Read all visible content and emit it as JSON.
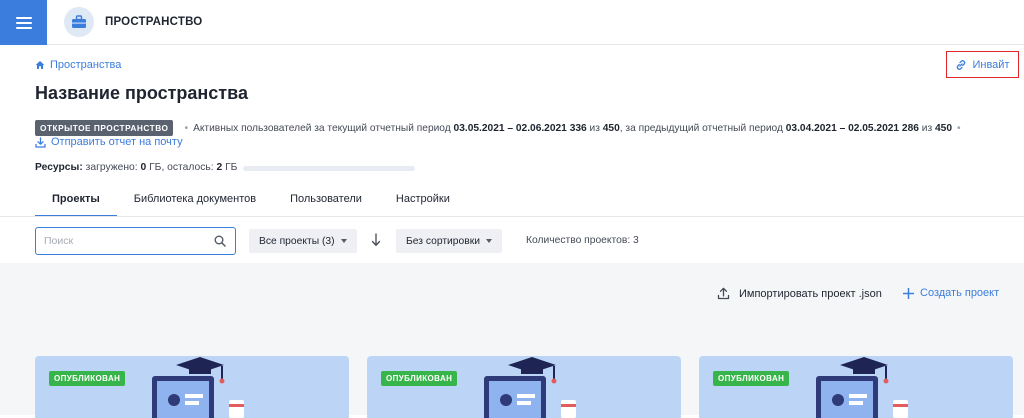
{
  "app": {
    "title": "ПРОСТРАНСТВО"
  },
  "breadcrumb": {
    "label": "Пространства"
  },
  "invite": {
    "label": "Инвайт"
  },
  "page": {
    "title": "Название пространства"
  },
  "space_info": {
    "badge": "ОТКРЫТОЕ ПРОСТРАНСТВО",
    "current_prefix": "Активных пользователей за текущий отчетный период",
    "current_period": "03.05.2021 – 02.06.2021",
    "current_active": "336",
    "of_word": "из",
    "current_total": "450",
    "previous_prefix": ", за предыдущий отчетный период",
    "previous_period": "03.04.2021 – 02.05.2021",
    "previous_active": "286",
    "previous_total": "450",
    "send_report": "Отправить отчет на почту"
  },
  "resources": {
    "label": "Ресурсы:",
    "loaded_label": "загружено:",
    "loaded_value": "0",
    "unit": "ГБ",
    "remaining_label": ", осталось:",
    "remaining_value": "2",
    "used_fraction": 0
  },
  "tabs": [
    {
      "label": "Проекты",
      "active": true
    },
    {
      "label": "Библиотека документов",
      "active": false
    },
    {
      "label": "Пользователи",
      "active": false
    },
    {
      "label": "Настройки",
      "active": false
    }
  ],
  "toolbar": {
    "search_placeholder": "Поиск",
    "filter_value": "Все проекты (3)",
    "sort_value": "Без сортировки",
    "count_text": "Количество проектов: 3"
  },
  "actions": {
    "import_label": "Импортировать проект .json",
    "create_label": "Создать проект"
  },
  "projects": [
    {
      "status": "ОПУБЛИКОВАН"
    },
    {
      "status": "ОПУБЛИКОВАН"
    },
    {
      "status": "ОПУБЛИКОВАН"
    }
  ],
  "colors": {
    "accent": "#3b7ddd",
    "published": "#38b54a",
    "invite_outline": "#e0262b",
    "badge": "#5a6270"
  },
  "icons": {
    "menu": "hamburger-icon",
    "logo": "briefcase-icon",
    "breadcrumb": "home-icon",
    "invite": "link-icon",
    "report": "download-icon",
    "search": "search-icon",
    "sort": "arrow-down-icon",
    "import": "upload-icon",
    "create": "plus-icon"
  }
}
